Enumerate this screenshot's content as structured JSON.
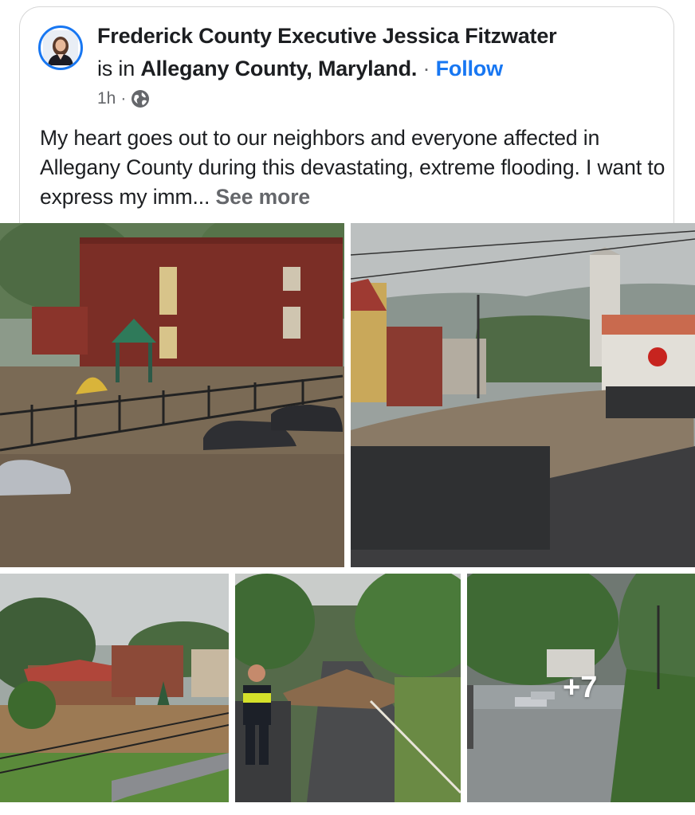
{
  "post": {
    "author": "Frederick County Executive Jessica Fitzwater",
    "location_prefix": "is in",
    "location": "Allegany County, Maryland.",
    "separator": "·",
    "follow_label": "Follow",
    "time": "1h",
    "privacy_icon": "globe-icon",
    "text": "My heart goes out to our neighbors and everyone affected in Allegany County during this devastating, extreme flooding. I want to express my imm...",
    "see_more_label": "See more"
  },
  "photos": {
    "extra_count_label": "+7",
    "descriptions": [
      "flooded-school-playground",
      "flooded-town-street",
      "flooded-riverside-houses",
      "emergency-worker-mudslide-road",
      "submerged-cars-road"
    ]
  },
  "colors": {
    "accent": "#1877f2",
    "text": "#1c1e21",
    "secondary": "#65676b"
  }
}
